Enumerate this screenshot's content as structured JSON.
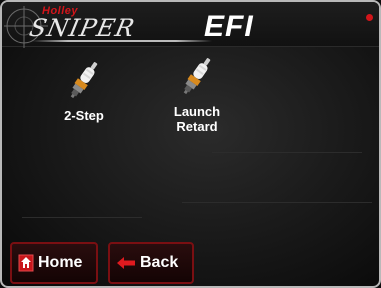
{
  "header": {
    "brand_small": "Holley",
    "brand_script": "SNIPER",
    "brand_bold": "EFI"
  },
  "features": [
    {
      "label": "2-Step",
      "icon": "spark-plug-icon"
    },
    {
      "label": "Launch\nRetard",
      "icon": "spark-plug-icon"
    }
  ],
  "nav": {
    "home_label": "Home",
    "back_label": "Back"
  },
  "colors": {
    "accent_red": "#d2151a",
    "button_border": "#7a0f12",
    "text": "#ffffff"
  }
}
